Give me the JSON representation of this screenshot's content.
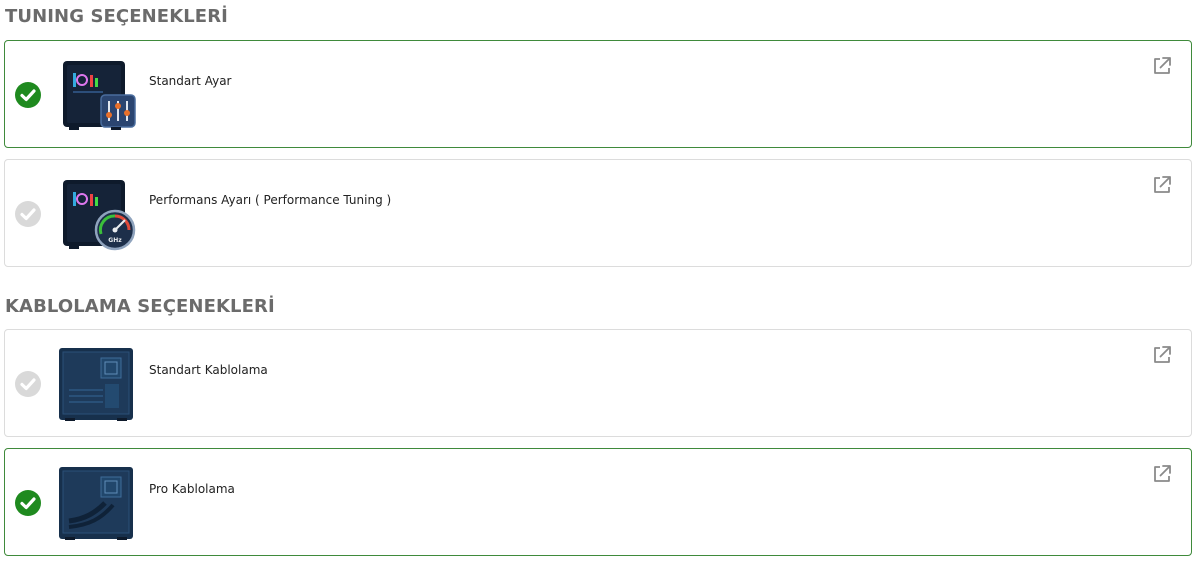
{
  "sections": [
    {
      "title": "TUNING SEÇENEKLERİ",
      "options": [
        {
          "label": "Standart Ayar",
          "selected": true
        },
        {
          "label": "Performans Ayarı ( Performance Tuning )",
          "selected": false
        }
      ]
    },
    {
      "title": "KABLOLAMA SEÇENEKLERİ",
      "options": [
        {
          "label": "Standart Kablolama",
          "selected": false
        },
        {
          "label": "Pro Kablolama",
          "selected": true
        }
      ]
    }
  ],
  "colors": {
    "selected_check": "#1f8a1f",
    "unselected_check": "#d9d9d9",
    "selected_border": "#3f8a3b",
    "section_title": "#6b6b6b"
  }
}
